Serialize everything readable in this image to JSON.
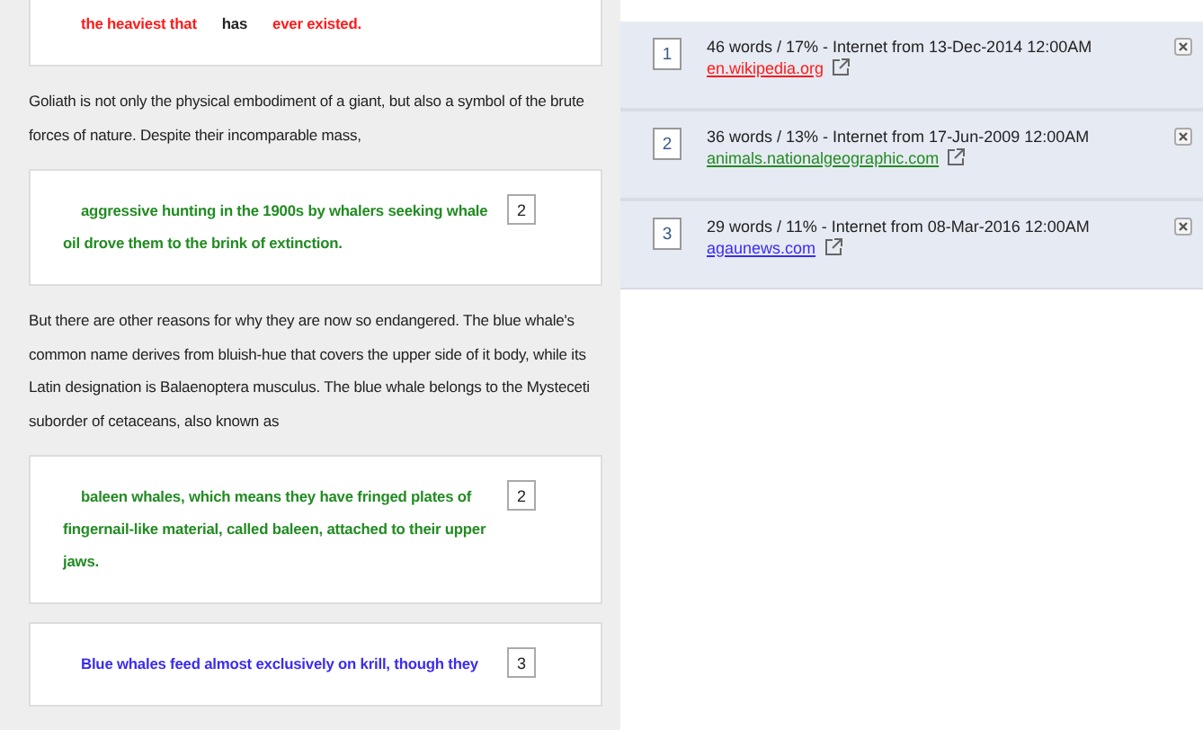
{
  "document": [
    {
      "kind": "match",
      "segments": [
        {
          "text": "the heaviest that",
          "color": "#ff1a1a"
        },
        {
          "text": "has",
          "color": "#222222"
        },
        {
          "text": "ever existed.",
          "color": "#ff1a1a"
        }
      ]
    },
    {
      "kind": "paragraph",
      "text": "Goliath is not only the physical embodiment of a giant, but also a symbol of the brute forces of nature. Despite their incomparable mass,"
    },
    {
      "kind": "match",
      "source": "2",
      "segments": [
        {
          "text": "aggressive hunting in the 1900s by whalers seeking whale oil drove them to the brink of extinction.",
          "color": "#228b22"
        }
      ]
    },
    {
      "kind": "paragraph",
      "text": "But there are other reasons for why they are now so endangered. The blue whale's common name derives from bluish-hue that covers the upper side of it body, while its Latin designation is Balaenoptera musculus. The blue whale belongs to the Mysteceti suborder of cetaceans, also known as"
    },
    {
      "kind": "match",
      "source": "2",
      "segments": [
        {
          "text": "baleen whales, which means they have fringed plates of fingernail-like material, called baleen, attached to their upper jaws.",
          "color": "#228b22"
        }
      ]
    },
    {
      "kind": "match",
      "source": "3",
      "segments": [
        {
          "text": "Blue whales feed almost exclusively on krill, though they",
          "color": "#3a2cf0"
        }
      ]
    }
  ],
  "sources": [
    {
      "number": "1",
      "summary": "46 words / 17% - Internet from 13-Dec-2014 12:00AM",
      "url": "en.wikipedia.org",
      "color": "#ff1a1a"
    },
    {
      "number": "2",
      "summary": "36 words / 13% - Internet from 17-Jun-2009 12:00AM",
      "url": "animals.nationalgeographic.com",
      "color": "#228b22"
    },
    {
      "number": "3",
      "summary": "29 words / 11% - Internet from 08-Mar-2016 12:00AM",
      "url": "agaunews.com",
      "color": "#3a2cf0"
    }
  ]
}
